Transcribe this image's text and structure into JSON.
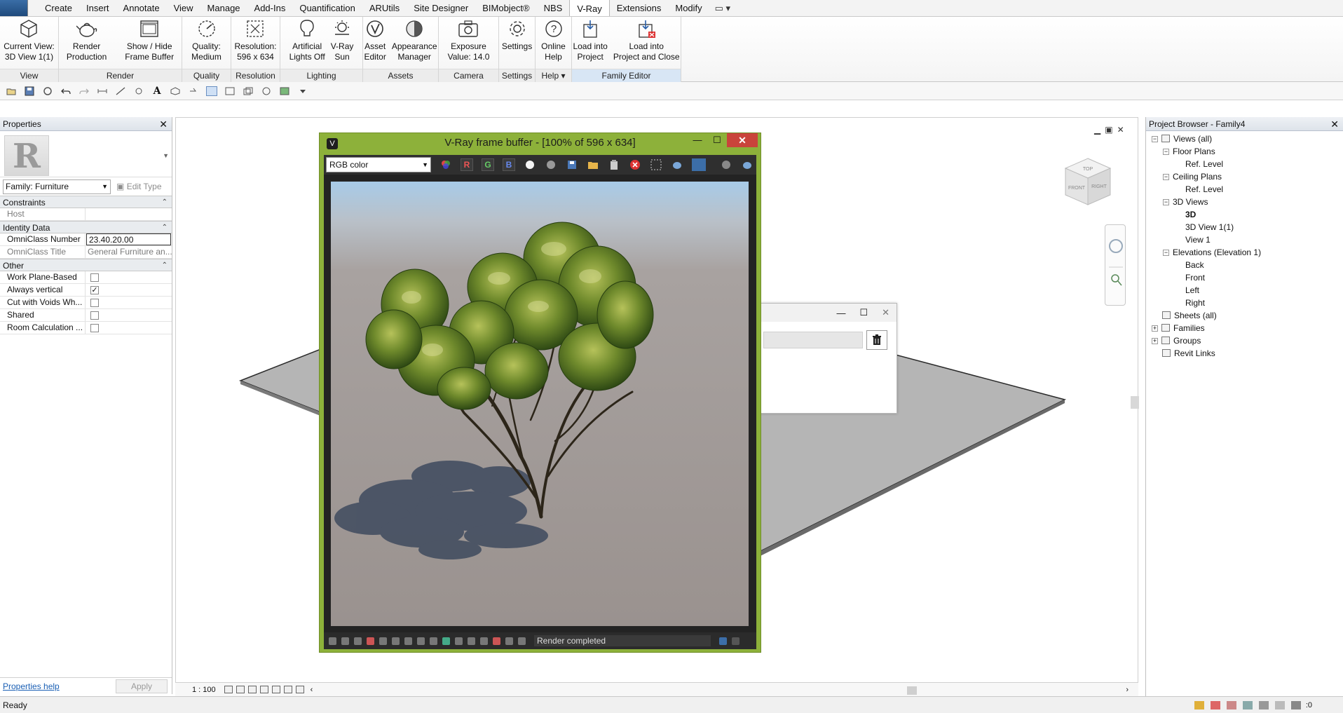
{
  "menu": {
    "tabs": [
      "Create",
      "Insert",
      "Annotate",
      "View",
      "Manage",
      "Add-Ins",
      "Quantification",
      "ARUtils",
      "Site Designer",
      "BIMobject®",
      "NBS",
      "V-Ray",
      "Extensions",
      "Modify"
    ],
    "active_tab": "V-Ray",
    "extra_dropdown": "▭ ▾"
  },
  "ribbon": {
    "current_view": {
      "label1": "Current View:",
      "label2": "3D View 1(1)"
    },
    "render_production": {
      "label1": "Render",
      "label2": "Production"
    },
    "show_hide_fb": {
      "label1": "Show / Hide",
      "label2": "Frame Buffer"
    },
    "quality": {
      "label1": "Quality:",
      "label2": "Medium"
    },
    "resolution": {
      "label1": "Resolution:",
      "label2": "596 x 634"
    },
    "artificial_lights": {
      "label1": "Artificial",
      "label2": "Lights Off"
    },
    "vray_sun": {
      "label1": "V-Ray",
      "label2": "Sun"
    },
    "asset_editor": {
      "label1": "Asset",
      "label2": "Editor"
    },
    "appearance_manager": {
      "label1": "Appearance",
      "label2": "Manager"
    },
    "exposure": {
      "label1": "Exposure",
      "label2": "Value: 14.0"
    },
    "settings": {
      "label1": "Settings"
    },
    "online_help": {
      "label1": "Online",
      "label2": "Help"
    },
    "load_into_project": {
      "label1": "Load into",
      "label2": "Project"
    },
    "load_into_project_close": {
      "label1": "Load into",
      "label2": "Project and Close"
    },
    "panels": {
      "view": "View",
      "render": "Render",
      "quality": "Quality",
      "resolution": "Resolution",
      "lighting": "Lighting",
      "assets": "Assets",
      "camera": "Camera",
      "settings": "Settings",
      "help": "Help ▾",
      "family_editor": "Family Editor"
    }
  },
  "properties": {
    "title": "Properties",
    "logo_letter": "R",
    "family": "Family: Furniture",
    "edit_type": "Edit Type",
    "groups": {
      "constraints": "Constraints",
      "identity": "Identity Data",
      "other": "Other"
    },
    "rows": {
      "host": "Host",
      "omniclass_number": {
        "k": "OmniClass Number",
        "v": "23.40.20.00"
      },
      "omniclass_title": {
        "k": "OmniClass Title",
        "v": "General Furniture an..."
      },
      "work_plane": "Work Plane-Based",
      "always_vertical": "Always vertical",
      "cut_with_voids": "Cut with Voids Wh...",
      "shared": "Shared",
      "room_calc": "Room Calculation ..."
    },
    "help_link": "Properties help",
    "apply": "Apply"
  },
  "vfb": {
    "title": "V-Ray frame buffer - [100% of 596 x 634]",
    "channel": "RGB color",
    "r": "R",
    "g": "G",
    "b": "B",
    "status": "Render completed"
  },
  "viewbar": {
    "scale": "1 : 100"
  },
  "browser": {
    "title": "Project Browser - Family4",
    "nodes": [
      {
        "label": "Views (all)",
        "lvl": 0,
        "toggle": "−",
        "icon": true
      },
      {
        "label": "Floor Plans",
        "lvl": 1,
        "toggle": "−"
      },
      {
        "label": "Ref. Level",
        "lvl": 2
      },
      {
        "label": "Ceiling Plans",
        "lvl": 1,
        "toggle": "−"
      },
      {
        "label": "Ref. Level",
        "lvl": 2
      },
      {
        "label": "3D Views",
        "lvl": 1,
        "toggle": "−"
      },
      {
        "label": "3D",
        "lvl": 2,
        "bold": true
      },
      {
        "label": "3D View 1(1)",
        "lvl": 2
      },
      {
        "label": "View 1",
        "lvl": 2
      },
      {
        "label": "Elevations (Elevation 1)",
        "lvl": 1,
        "toggle": "−"
      },
      {
        "label": "Back",
        "lvl": 2
      },
      {
        "label": "Front",
        "lvl": 2
      },
      {
        "label": "Left",
        "lvl": 2
      },
      {
        "label": "Right",
        "lvl": 2
      },
      {
        "label": "Sheets (all)",
        "lvl": 0,
        "icon": true
      },
      {
        "label": "Families",
        "lvl": 0,
        "toggle": "+",
        "icon": true
      },
      {
        "label": "Groups",
        "lvl": 0,
        "toggle": "+",
        "icon": true
      },
      {
        "label": "Revit Links",
        "lvl": 0,
        "icon": true
      }
    ]
  },
  "status": {
    "text": "Ready",
    "filter_count": ":0"
  },
  "viewcube": {
    "top": "TOP",
    "front": "FRONT",
    "right": "RIGHT"
  },
  "colors": {
    "vfb_frame": "#8db13a",
    "close_red": "#c9443b",
    "active_tab": "#ffffff"
  }
}
